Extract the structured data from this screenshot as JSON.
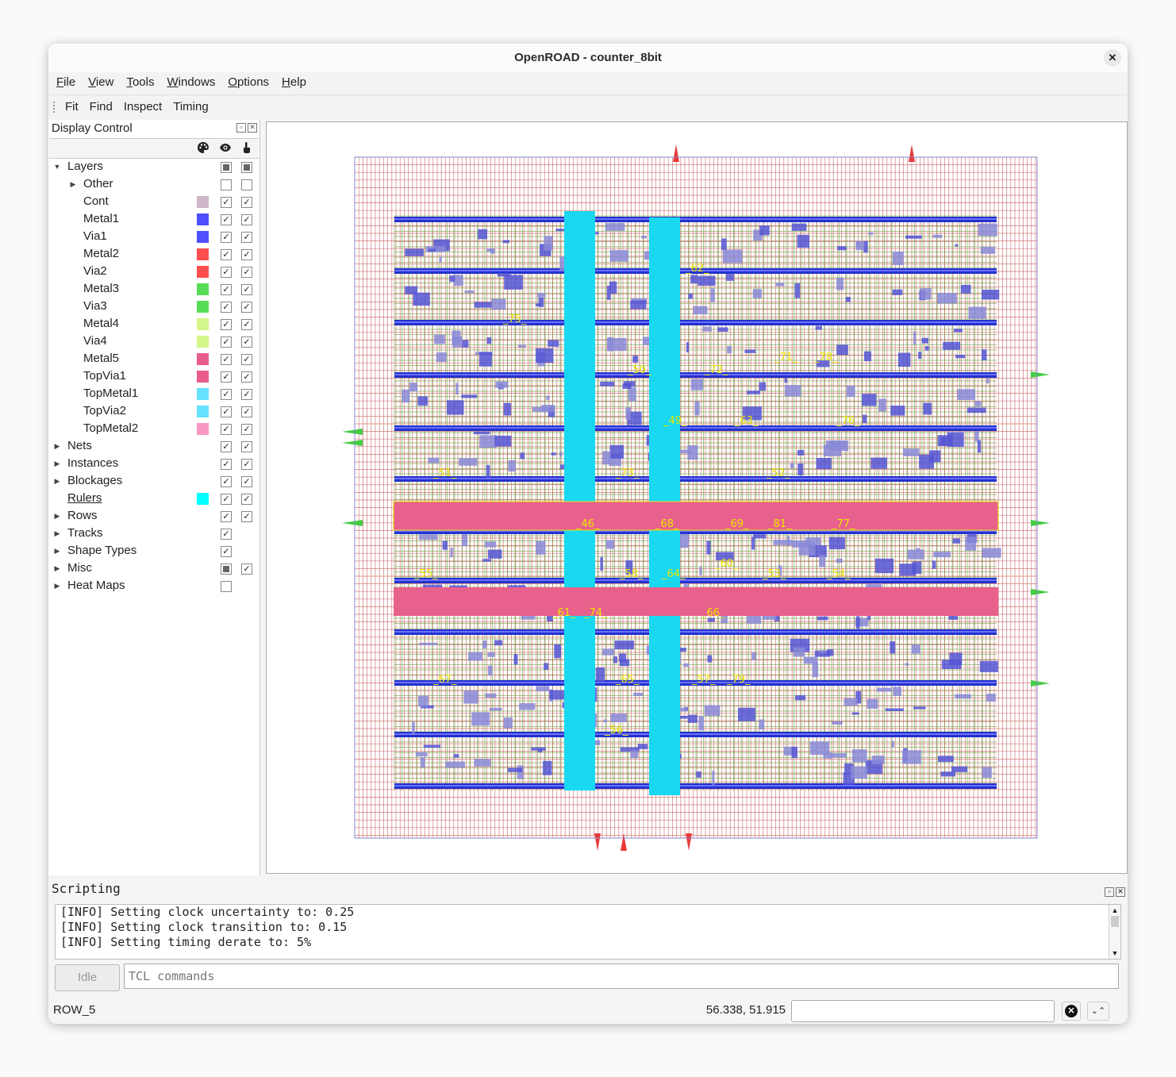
{
  "window": {
    "title": "OpenROAD - counter_8bit",
    "close_glyph": "✕"
  },
  "menu": [
    "File",
    "View",
    "Tools",
    "Windows",
    "Options",
    "Help"
  ],
  "toolbar": [
    "Fit",
    "Find",
    "Inspect",
    "Timing"
  ],
  "display_control": {
    "title": "Display Control",
    "header_icons": [
      "palette-icon",
      "eye-icon",
      "pointer-icon"
    ],
    "items": [
      {
        "label": "Layers",
        "level": 0,
        "expand": "open",
        "swatch": null,
        "visible": "partial",
        "selectable": "partial"
      },
      {
        "label": "Other",
        "level": 1,
        "expand": "closed",
        "swatch": null,
        "visible": "off",
        "selectable": "off"
      },
      {
        "label": "Cont",
        "level": 1,
        "expand": "none",
        "swatch": "#cdb6c6",
        "visible": "on",
        "selectable": "on"
      },
      {
        "label": "Metal1",
        "level": 1,
        "expand": "none",
        "swatch": "#4f4fff",
        "visible": "on",
        "selectable": "on"
      },
      {
        "label": "Via1",
        "level": 1,
        "expand": "none",
        "swatch": "#4f4fff",
        "visible": "on",
        "selectable": "on"
      },
      {
        "label": "Metal2",
        "level": 1,
        "expand": "none",
        "swatch": "#ff4f4f",
        "visible": "on",
        "selectable": "on"
      },
      {
        "label": "Via2",
        "level": 1,
        "expand": "none",
        "swatch": "#ff4f4f",
        "visible": "on",
        "selectable": "on"
      },
      {
        "label": "Metal3",
        "level": 1,
        "expand": "none",
        "swatch": "#55dd55",
        "visible": "on",
        "selectable": "on"
      },
      {
        "label": "Via3",
        "level": 1,
        "expand": "none",
        "swatch": "#55dd55",
        "visible": "on",
        "selectable": "on"
      },
      {
        "label": "Metal4",
        "level": 1,
        "expand": "none",
        "swatch": "#d4f58a",
        "visible": "on",
        "selectable": "on"
      },
      {
        "label": "Via4",
        "level": 1,
        "expand": "none",
        "swatch": "#d4f58a",
        "visible": "on",
        "selectable": "on"
      },
      {
        "label": "Metal5",
        "level": 1,
        "expand": "none",
        "swatch": "#e85c8c",
        "visible": "on",
        "selectable": "on"
      },
      {
        "label": "TopVia1",
        "level": 1,
        "expand": "none",
        "swatch": "#e85c8c",
        "visible": "on",
        "selectable": "on"
      },
      {
        "label": "TopMetal1",
        "level": 1,
        "expand": "none",
        "swatch": "#66e0ff",
        "visible": "on",
        "selectable": "on"
      },
      {
        "label": "TopVia2",
        "level": 1,
        "expand": "none",
        "swatch": "#66e0ff",
        "visible": "on",
        "selectable": "on"
      },
      {
        "label": "TopMetal2",
        "level": 1,
        "expand": "none",
        "swatch": "#f799c2",
        "visible": "on",
        "selectable": "on"
      },
      {
        "label": "Nets",
        "level": 0,
        "expand": "closed",
        "swatch": null,
        "visible": "on",
        "selectable": "on"
      },
      {
        "label": "Instances",
        "level": 0,
        "expand": "closed",
        "swatch": null,
        "visible": "on",
        "selectable": "on"
      },
      {
        "label": "Blockages",
        "level": 0,
        "expand": "closed",
        "swatch": null,
        "visible": "on",
        "selectable": "on"
      },
      {
        "label": "Rulers",
        "level": 0,
        "expand": "none",
        "swatch": "#00ffff",
        "visible": "on",
        "selectable": "on",
        "underline": true
      },
      {
        "label": "Rows",
        "level": 0,
        "expand": "closed",
        "swatch": null,
        "visible": "on",
        "selectable": "on"
      },
      {
        "label": "Tracks",
        "level": 0,
        "expand": "closed",
        "swatch": null,
        "visible": "on",
        "selectable": "none"
      },
      {
        "label": "Shape Types",
        "level": 0,
        "expand": "closed",
        "swatch": null,
        "visible": "on",
        "selectable": "none"
      },
      {
        "label": "Misc",
        "level": 0,
        "expand": "closed",
        "swatch": null,
        "visible": "partial",
        "selectable": "on"
      },
      {
        "label": "Heat Maps",
        "level": 0,
        "expand": "closed",
        "swatch": null,
        "visible": "off",
        "selectable": "none"
      }
    ]
  },
  "layout_view": {
    "colors": {
      "background": "#ffffff",
      "metal2_grid": "#c0504d",
      "metal3_grid": "#6fae4f",
      "metal1_rail": "#2233cc",
      "topmetal1": "#19d8f0",
      "metal5": "#e8608c",
      "pins": "#e83a3a",
      "io_pins": "#44cc44",
      "labels": "#e8e800"
    },
    "net_labels": [
      "_62_",
      "_75_",
      "_50_",
      "_72_",
      "_71_",
      "_78_",
      "_49_",
      "_63_",
      "_76_",
      "_51_",
      "_73_",
      "_52_",
      "_46_",
      "_68_",
      "_69_",
      "_81_",
      "_77_",
      "_55_",
      "_58_",
      "_64_",
      "_60_",
      "_53_",
      "_54_",
      "_61_",
      "_74_",
      "_66_",
      "_67_",
      "_65_",
      "_57_",
      "_79_",
      "_56_"
    ]
  },
  "scripting": {
    "title": "Scripting",
    "lines": [
      "[INFO] Setting clock uncertainty to: 0.25",
      "[INFO] Setting clock transition to: 0.15",
      "[INFO] Setting timing derate to: 5%"
    ],
    "idle_label": "Idle",
    "placeholder": "TCL commands"
  },
  "status": {
    "selected": "ROW_5",
    "coordinates": "56.338, 51.915"
  }
}
